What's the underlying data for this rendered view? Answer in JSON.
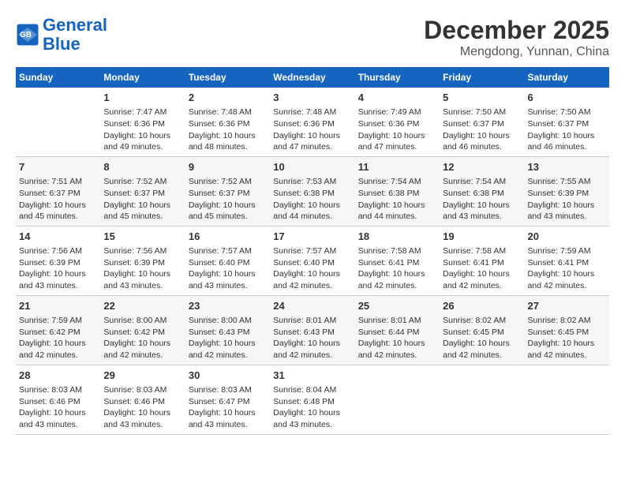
{
  "header": {
    "logo_line1": "General",
    "logo_line2": "Blue",
    "month": "December 2025",
    "location": "Mengdong, Yunnan, China"
  },
  "days_of_week": [
    "Sunday",
    "Monday",
    "Tuesday",
    "Wednesday",
    "Thursday",
    "Friday",
    "Saturday"
  ],
  "weeks": [
    [
      {
        "day": "",
        "text": ""
      },
      {
        "day": "1",
        "text": "Sunrise: 7:47 AM\nSunset: 6:36 PM\nDaylight: 10 hours and 49 minutes."
      },
      {
        "day": "2",
        "text": "Sunrise: 7:48 AM\nSunset: 6:36 PM\nDaylight: 10 hours and 48 minutes."
      },
      {
        "day": "3",
        "text": "Sunrise: 7:48 AM\nSunset: 6:36 PM\nDaylight: 10 hours and 47 minutes."
      },
      {
        "day": "4",
        "text": "Sunrise: 7:49 AM\nSunset: 6:36 PM\nDaylight: 10 hours and 47 minutes."
      },
      {
        "day": "5",
        "text": "Sunrise: 7:50 AM\nSunset: 6:37 PM\nDaylight: 10 hours and 46 minutes."
      },
      {
        "day": "6",
        "text": "Sunrise: 7:50 AM\nSunset: 6:37 PM\nDaylight: 10 hours and 46 minutes."
      }
    ],
    [
      {
        "day": "7",
        "text": "Sunrise: 7:51 AM\nSunset: 6:37 PM\nDaylight: 10 hours and 45 minutes."
      },
      {
        "day": "8",
        "text": "Sunrise: 7:52 AM\nSunset: 6:37 PM\nDaylight: 10 hours and 45 minutes."
      },
      {
        "day": "9",
        "text": "Sunrise: 7:52 AM\nSunset: 6:37 PM\nDaylight: 10 hours and 45 minutes."
      },
      {
        "day": "10",
        "text": "Sunrise: 7:53 AM\nSunset: 6:38 PM\nDaylight: 10 hours and 44 minutes."
      },
      {
        "day": "11",
        "text": "Sunrise: 7:54 AM\nSunset: 6:38 PM\nDaylight: 10 hours and 44 minutes."
      },
      {
        "day": "12",
        "text": "Sunrise: 7:54 AM\nSunset: 6:38 PM\nDaylight: 10 hours and 43 minutes."
      },
      {
        "day": "13",
        "text": "Sunrise: 7:55 AM\nSunset: 6:39 PM\nDaylight: 10 hours and 43 minutes."
      }
    ],
    [
      {
        "day": "14",
        "text": "Sunrise: 7:56 AM\nSunset: 6:39 PM\nDaylight: 10 hours and 43 minutes."
      },
      {
        "day": "15",
        "text": "Sunrise: 7:56 AM\nSunset: 6:39 PM\nDaylight: 10 hours and 43 minutes."
      },
      {
        "day": "16",
        "text": "Sunrise: 7:57 AM\nSunset: 6:40 PM\nDaylight: 10 hours and 43 minutes."
      },
      {
        "day": "17",
        "text": "Sunrise: 7:57 AM\nSunset: 6:40 PM\nDaylight: 10 hours and 42 minutes."
      },
      {
        "day": "18",
        "text": "Sunrise: 7:58 AM\nSunset: 6:41 PM\nDaylight: 10 hours and 42 minutes."
      },
      {
        "day": "19",
        "text": "Sunrise: 7:58 AM\nSunset: 6:41 PM\nDaylight: 10 hours and 42 minutes."
      },
      {
        "day": "20",
        "text": "Sunrise: 7:59 AM\nSunset: 6:41 PM\nDaylight: 10 hours and 42 minutes."
      }
    ],
    [
      {
        "day": "21",
        "text": "Sunrise: 7:59 AM\nSunset: 6:42 PM\nDaylight: 10 hours and 42 minutes."
      },
      {
        "day": "22",
        "text": "Sunrise: 8:00 AM\nSunset: 6:42 PM\nDaylight: 10 hours and 42 minutes."
      },
      {
        "day": "23",
        "text": "Sunrise: 8:00 AM\nSunset: 6:43 PM\nDaylight: 10 hours and 42 minutes."
      },
      {
        "day": "24",
        "text": "Sunrise: 8:01 AM\nSunset: 6:43 PM\nDaylight: 10 hours and 42 minutes."
      },
      {
        "day": "25",
        "text": "Sunrise: 8:01 AM\nSunset: 6:44 PM\nDaylight: 10 hours and 42 minutes."
      },
      {
        "day": "26",
        "text": "Sunrise: 8:02 AM\nSunset: 6:45 PM\nDaylight: 10 hours and 42 minutes."
      },
      {
        "day": "27",
        "text": "Sunrise: 8:02 AM\nSunset: 6:45 PM\nDaylight: 10 hours and 42 minutes."
      }
    ],
    [
      {
        "day": "28",
        "text": "Sunrise: 8:03 AM\nSunset: 6:46 PM\nDaylight: 10 hours and 43 minutes."
      },
      {
        "day": "29",
        "text": "Sunrise: 8:03 AM\nSunset: 6:46 PM\nDaylight: 10 hours and 43 minutes."
      },
      {
        "day": "30",
        "text": "Sunrise: 8:03 AM\nSunset: 6:47 PM\nDaylight: 10 hours and 43 minutes."
      },
      {
        "day": "31",
        "text": "Sunrise: 8:04 AM\nSunset: 6:48 PM\nDaylight: 10 hours and 43 minutes."
      },
      {
        "day": "",
        "text": ""
      },
      {
        "day": "",
        "text": ""
      },
      {
        "day": "",
        "text": ""
      }
    ]
  ]
}
